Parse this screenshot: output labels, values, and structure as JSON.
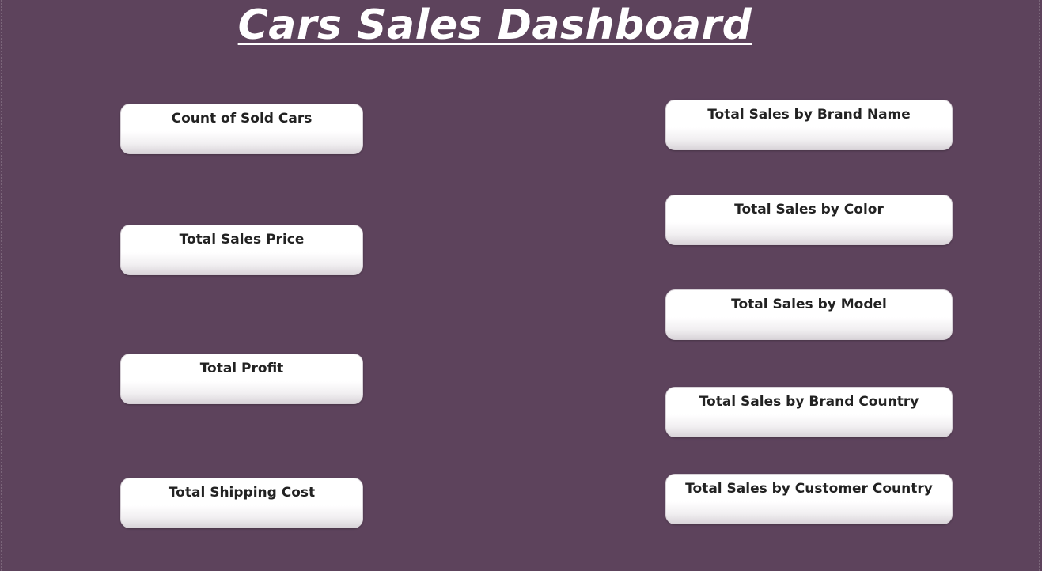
{
  "dashboard": {
    "title": "Cars Sales Dashboard"
  },
  "kpi_cards": [
    {
      "label": "Count of Sold Cars"
    },
    {
      "label": "Total Sales Price"
    },
    {
      "label": "Total Profit"
    },
    {
      "label": "Total Shipping Cost"
    }
  ],
  "breakdown_cards": [
    {
      "label": "Total Sales by Brand Name"
    },
    {
      "label": "Total Sales by Color"
    },
    {
      "label": "Total Sales by Model"
    },
    {
      "label": "Total Sales by Brand Country"
    },
    {
      "label": "Total Sales by Customer Country"
    }
  ],
  "colors": {
    "background": "#5d435c",
    "card": "#ffffff",
    "card_text": "#222222",
    "title_text": "#ffffff"
  }
}
